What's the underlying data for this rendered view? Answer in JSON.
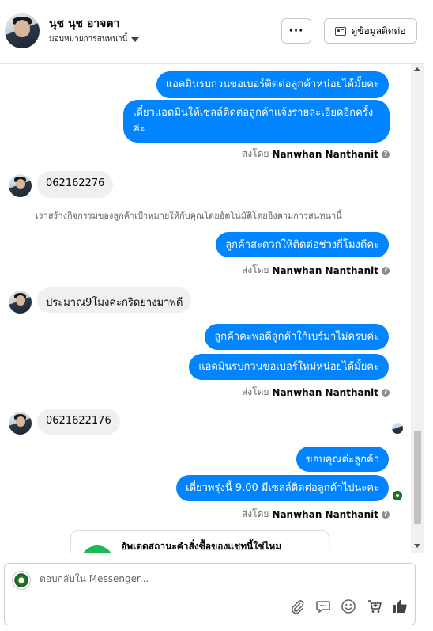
{
  "header": {
    "name": "นุช นุช อาจตา",
    "assign_label": "มอบหมายการสนทนานี้",
    "more_label": "···",
    "contact_button_label": "ดูข้อมูลติดต่อ"
  },
  "messages": {
    "out1": "แอดมินรบกวนขอเบอร์ติดต่อลูกค้าหน่อยได้มั้ยคะ",
    "out2": "เดี๋ยวแอดมินให้เซลล์ติดต่อลูกค้าแจ้งรายละเอียดอีกครั้งค่ะ",
    "sent_by_1": "ส่งโดย",
    "agent_1": "Nanwhan Nanthanit",
    "in1": "062162276",
    "system_note": "เราสร้างกิจกรรมของลูกค้าเป้าหมายให้กับคุณโดยอัตโนมัติโดยอิงตามการสนทนานี้",
    "out3": "ลูกค้าสะดวกให้ติดต่อช่วงกี่โมงดีคะ",
    "sent_by_2": "ส่งโดย",
    "agent_2": "Nanwhan Nanthanit",
    "in2": "ประมาณ9โมงคะกริดยางมาพดี",
    "out4": "ลูกค้าคะพอดีลูกค้าใก้เบร์มาไม่ครบค่ะ",
    "out5": "แอดมินรบกวนขอเบอร์ใหม่หน่อยได้มั้ยคะ",
    "sent_by_3": "ส่งโดย",
    "agent_3": "Nanwhan Nanthanit",
    "in3": "0621622176",
    "out6": "ขอบคุณค่ะลูกค้า",
    "out7": "เดี๋ยวพรุ่งนี้ 9.00 มีเซลล์ติดต่อลูกค้าไปนะคะ",
    "sent_by_4": "ส่งโดย",
    "agent_4": "Nanwhan Nanthanit"
  },
  "card": {
    "title": "อัพเดตสถานะคำสั่งซื้อของแชทนี้ใช่ไหม"
  },
  "composer": {
    "placeholder": "ตอบกลับใน Messenger..."
  },
  "icons": [
    "attachment-icon",
    "saved-reply-icon",
    "emoji-icon",
    "cart-icon",
    "thumbs-up-icon"
  ],
  "colors": {
    "outgoing_bubble": "#0084ff",
    "incoming_bubble": "#f0f0f0",
    "card_icon": "#1db954"
  }
}
